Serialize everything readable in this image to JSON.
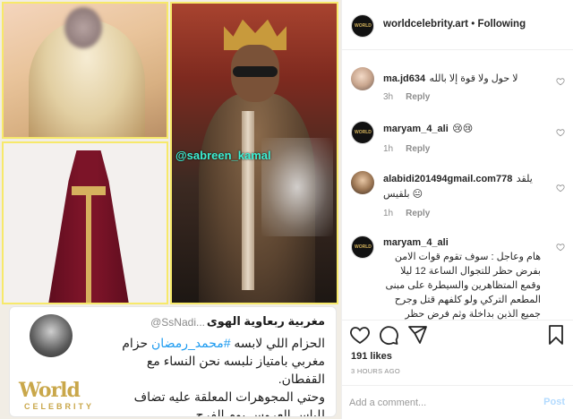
{
  "post": {
    "watermark_handle": "@sabreen_kamal",
    "tweet": {
      "display_name": "مغربية ربعاوية الهوى",
      "handle": "@SsNadi...",
      "line1_pre": "الحزام اللي لابسه ",
      "line1_hash": "#محمد_رمضان",
      "line1_post": " حزام",
      "line2": "مغربي بامتياز نلبسه نحن النساء مع",
      "line3": "القفطان.",
      "line4": "وحتي المجوهرات المعلقة عليه تضاف",
      "line5": "للباس العروس يوم الفرح"
    },
    "logo_word": "World",
    "logo_sub": "CELEBRITY"
  },
  "header": {
    "username": "worldcelebrity.art",
    "separator": "•",
    "follow_label": "Following"
  },
  "comments": [
    {
      "user": "ma.jd634",
      "text": "لا حول ولا قوة إلا بالله",
      "time": "3h",
      "reply": "Reply"
    },
    {
      "user": "maryam_4_ali",
      "text": "😢😢",
      "time": "1h",
      "reply": "Reply"
    },
    {
      "user": "alabidi201494gmail.com778",
      "text": "يلقد بلقيس 😐",
      "time": "1h",
      "reply": "Reply"
    },
    {
      "user": "maryam_4_ali",
      "text": "هام وعاجل : سوف تقوم قوات الامن بفرض حظر للتجوال الساعة 12 ليلا وقمع المتظاهرين والسيطرة على مبنى المطعم التركي ولو كلفهم قتل وجرح جميع الذين بداخلة وثم فرض حظر للتجوال حتى لا تصل الناس",
      "time": "",
      "reply": ""
    }
  ],
  "likes": "191 likes",
  "time_ago": "3 HOURS AGO",
  "add_comment": {
    "placeholder": "Add a comment...",
    "post_label": "Post"
  },
  "avatar_brand_text": "WORLD"
}
